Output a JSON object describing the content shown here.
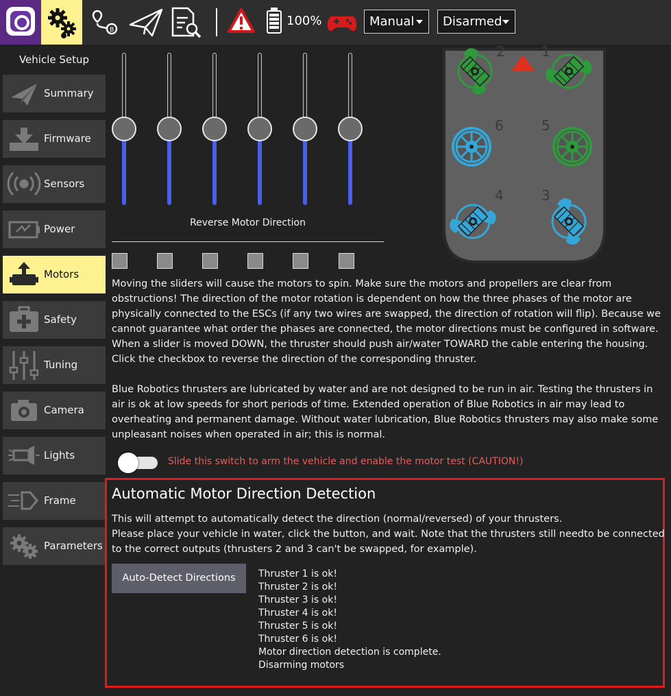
{
  "toolbar": {
    "battery_percent": "100%",
    "flight_mode": "Manual",
    "arm_state": "Disarmed",
    "icons": [
      "qgc-logo-icon",
      "vehicle-setup-gear-icon",
      "plan-route-icon",
      "fly-paper-plane-icon",
      "analyze-document-icon",
      "warning-triangle-icon",
      "battery-icon",
      "joystick-gamepad-icon"
    ],
    "colors": {
      "active_tab": "#fdf28f",
      "logo_bg": "#5b2b84",
      "warning": "#e01b1b"
    }
  },
  "sidebar": {
    "title": "Vehicle Setup",
    "items": [
      {
        "label": "Summary",
        "icon": "paper-plane-icon"
      },
      {
        "label": "Firmware",
        "icon": "download-icon"
      },
      {
        "label": "Sensors",
        "icon": "radio-waves-icon"
      },
      {
        "label": "Power",
        "icon": "battery-bolt-icon"
      },
      {
        "label": "Motors",
        "icon": "motor-icon",
        "active": true
      },
      {
        "label": "Safety",
        "icon": "first-aid-icon"
      },
      {
        "label": "Tuning",
        "icon": "sliders-icon"
      },
      {
        "label": "Camera",
        "icon": "camera-icon"
      },
      {
        "label": "Lights",
        "icon": "light-icon"
      },
      {
        "label": "Frame",
        "icon": "frame-icon"
      },
      {
        "label": "Parameters",
        "icon": "gears-icon"
      }
    ]
  },
  "motors": {
    "slider_count": 6,
    "slider_level": 0.5,
    "reverse_label": "Reverse Motor Direction",
    "reverse_checked": [
      false,
      false,
      false,
      false,
      false,
      false
    ],
    "description": "Moving the sliders will cause the motors to spin. Make sure the motors and propellers are clear from obstructions! The direction of the motor rotation is dependent on how the three phases of the motor are physically connected to the ESCs (if any two wires are swapped, the direction of rotation will flip). Because we cannot guarantee what order the phases are connected, the motor directions must be configured in software. When a slider is moved DOWN, the thruster should push air/water TOWARD the cable entering the housing. Click the checkbox to reverse the direction of the corresponding thruster.",
    "warning": "Blue Robotics thrusters are lubricated by water and are not designed to be run in air. Testing the thrusters in air is ok at low speeds for short periods of time. Extended operation of Blue Robotics in air may lead to overheating and permanent damage. Without water lubrication, Blue Robotics thrusters may also make some unpleasant noises when operated in air; this is normal.",
    "arm_switch_label": "Slide this switch to arm the vehicle and enable the motor test (CAUTION!)",
    "arm_switch_on": false,
    "thruster_numbers": [
      "2",
      "1",
      "6",
      "5",
      "4",
      "3"
    ]
  },
  "auto_detect": {
    "title": "Automatic Motor Direction Detection",
    "line1": "This will attempt to automatically detect the direction (normal/reversed) of your thrusters.",
    "line2": "Please place your vehicle in water, click the button, and wait. Note that the thrusters still needto be connected to the correct outputs (thrusters 2 and 3 can't be swapped, for example).",
    "button_label": "Auto-Detect Directions",
    "log": [
      "Thruster 1 is ok!",
      "Thruster 2 is ok!",
      "Thruster 3 is ok!",
      "Thruster 4 is ok!",
      "Thruster 5 is ok!",
      "Thruster 6 is ok!",
      "Motor direction detection is complete.",
      "Disarming motors"
    ]
  }
}
